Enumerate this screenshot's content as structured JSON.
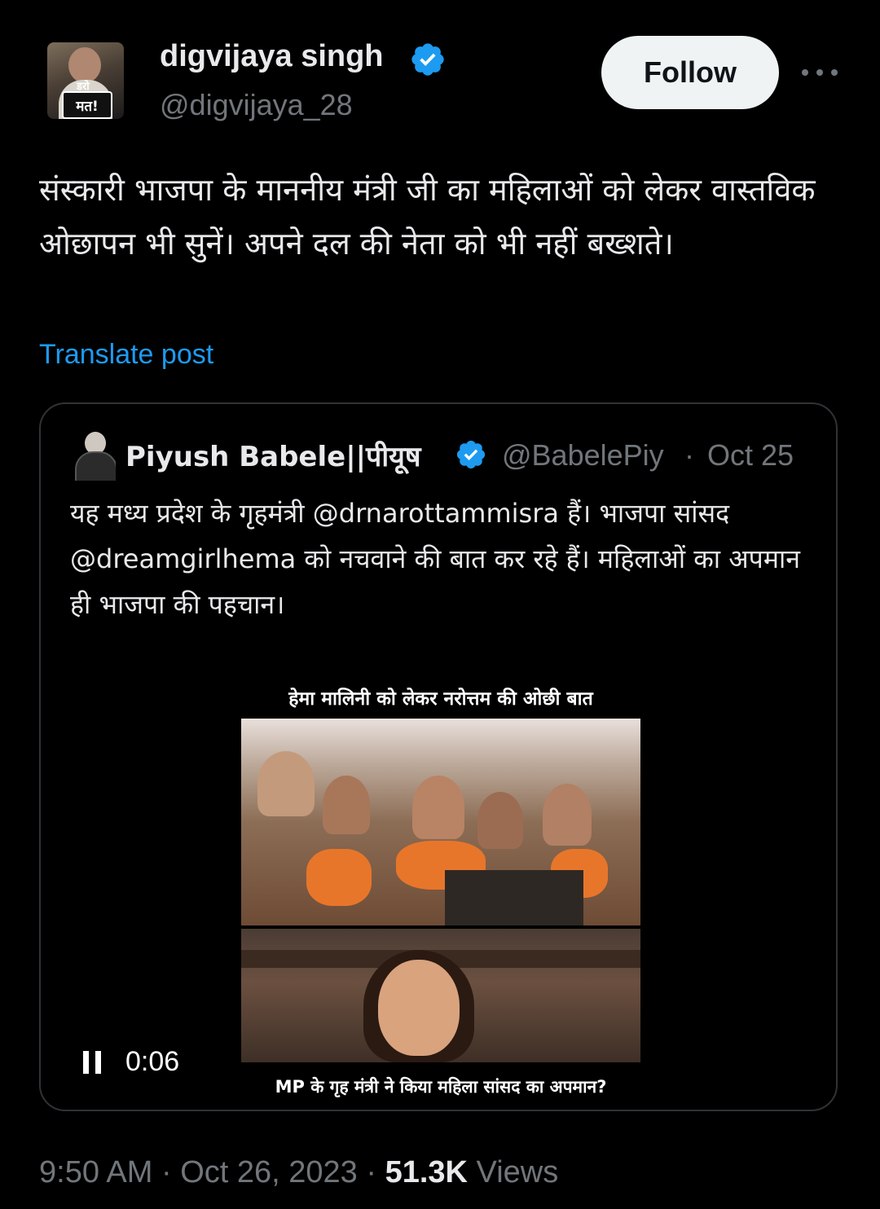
{
  "post": {
    "author_name": "digvijaya singh",
    "author_handle": "@digvijaya_28",
    "avatar_badge_small": "डरो",
    "avatar_badge": "मत!",
    "follow_label": "Follow",
    "text": "संस्कारी भाजपा के माननीय मंत्री जी का महिलाओं को लेकर वास्तविक ओछापन भी सुनें। अपने दल की नेता को भी नहीं बख्शते।",
    "translate_label": "Translate post",
    "time": "9:50 AM",
    "date": "Oct 26, 2023",
    "views_count": "51.3K",
    "views_label": "Views",
    "separator": "·"
  },
  "quoted": {
    "author_name": "Piyush Babele||पीयूष",
    "author_handle": "@BabelePiy",
    "separator": "·",
    "date": "Oct 25",
    "text": "यह मध्य प्रदेश के गृहमंत्री @drnarottammisra हैं। भाजपा सांसद @dreamgirlhema को नचवाने की बात कर रहे हैं। महिलाओं का अपमान ही भाजपा की पहचान।",
    "video": {
      "title": "हेमा मालिनी को लेकर नरोत्तम की ओछी बात",
      "caption": "MP के गृह मंत्री ने किया महिला सांसद का अपमान?",
      "time": "0:06"
    }
  },
  "colors": {
    "background": "#000000",
    "text": "#e7e9ea",
    "muted": "#71767b",
    "link": "#1d9bf0",
    "verified": "#1d9bf0",
    "follow_bg": "#eff3f4"
  },
  "icons": [
    "verified-badge-icon",
    "more-options-icon",
    "pause-icon"
  ]
}
